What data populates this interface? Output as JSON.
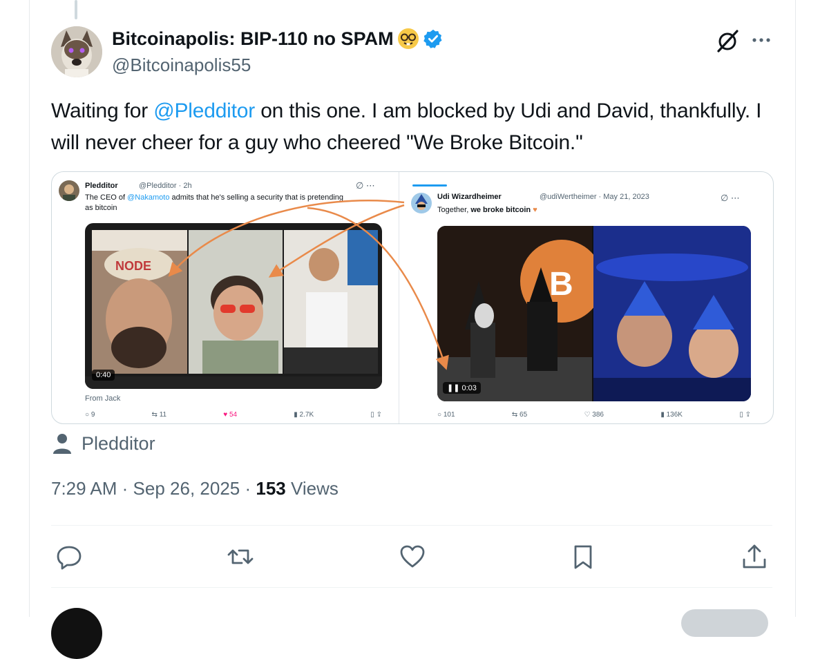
{
  "tweet": {
    "display_name": "Bitcoinapolis: BIP-110 no SPAM",
    "handle": "@Bitcoinapolis55",
    "text_before": "Waiting for ",
    "mention": "@Pledditor",
    "text_after": " on this one. I am blocked by Udi and David, thankfully. I will never cheer for a guy who cheered \"We Broke Bitcoin.\"",
    "attribution": "Pledditor",
    "time": "7:29 AM",
    "date": "Sep 26, 2025",
    "dot": "·",
    "views_count": "153",
    "views_label": "Views"
  },
  "icons": {
    "verified": "verified-badge-icon",
    "nerd": "nerd-face-emoji-icon",
    "grok": "grok-icon",
    "more": "more-icon",
    "person": "person-icon",
    "reply": "reply-icon",
    "retweet": "retweet-icon",
    "like": "like-icon",
    "bookmark": "bookmark-icon",
    "share": "share-icon"
  },
  "embedded_left": {
    "name": "Pledditor",
    "meta": "@Pledditor · 2h",
    "text_pre": "The CEO of ",
    "text_mention": "@Nakamoto",
    "text_post": " admits that he's selling a security that is pretending as bitcoin",
    "video_time": "0:40",
    "from_label": "From Jack",
    "stats": {
      "replies": "9",
      "reposts": "11",
      "likes": "54",
      "views": "2.7K"
    }
  },
  "embedded_right": {
    "name": "Udi Wizardheimer",
    "meta": "@udiWertheimer · May 21, 2023",
    "text_pre": "Together, ",
    "text_bold": "we broke bitcoin",
    "video_time": "0:03",
    "stats": {
      "replies": "101",
      "reposts": "65",
      "likes": "386",
      "views": "136K"
    }
  },
  "colors": {
    "accent": "#1d9bf0",
    "text": "#0f1419",
    "secondary": "#536471",
    "arrow": "#e98a4a"
  }
}
